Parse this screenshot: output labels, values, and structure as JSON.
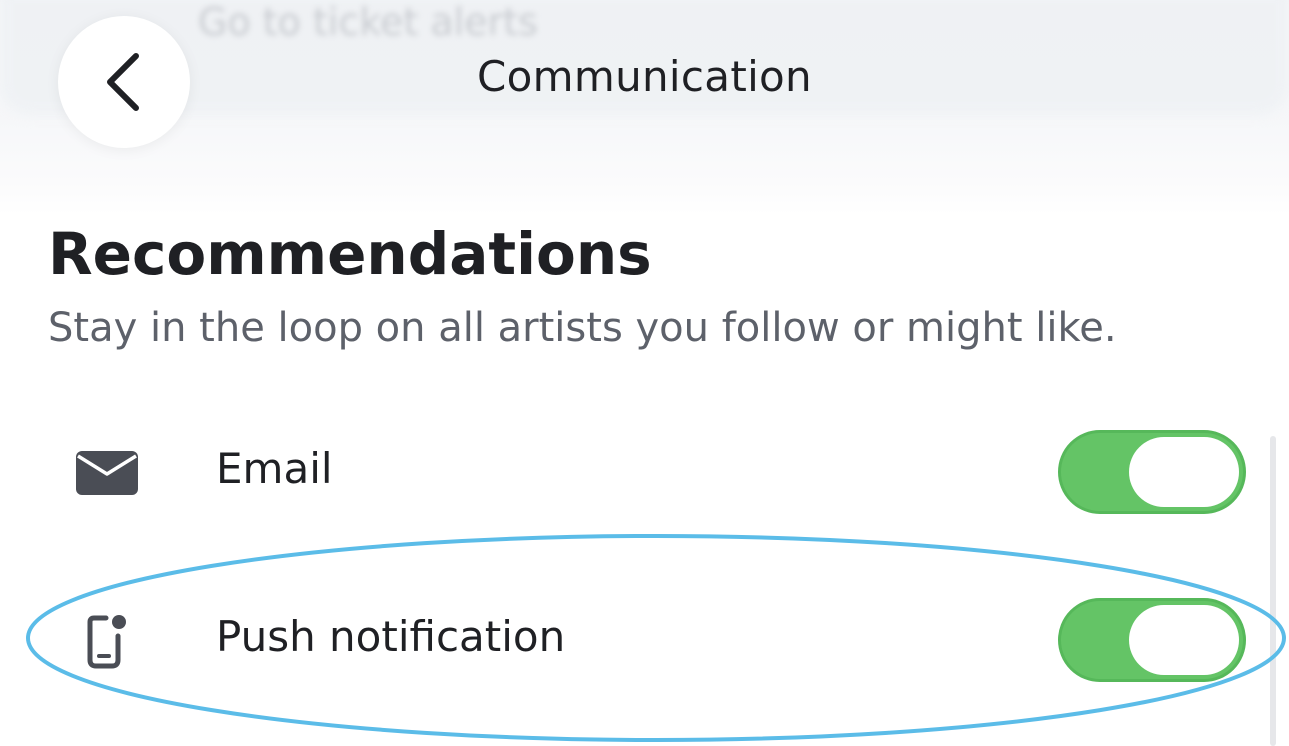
{
  "ghost": {
    "text": "Go to ticket alerts"
  },
  "header": {
    "title": "Communication",
    "back_icon": "chevron-left-icon"
  },
  "section": {
    "title": "Recommendations",
    "description": "Stay in the loop on all artists you follow or might like."
  },
  "channels": [
    {
      "label": "Email",
      "icon": "envelope-icon",
      "enabled": true
    },
    {
      "label": "Push notification",
      "icon": "phone-notification-icon",
      "enabled": true
    }
  ],
  "colors": {
    "toggle_on": "#64c466",
    "highlight": "#5bbce8",
    "text_primary": "#1f2024",
    "text_secondary": "#5d616a"
  }
}
